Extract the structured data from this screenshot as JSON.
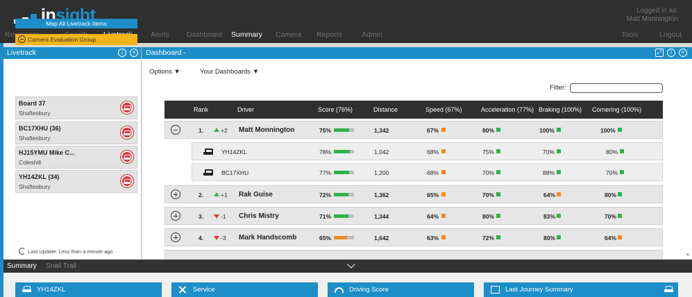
{
  "app": {
    "logo_text_white": "in",
    "logo_text_blue": "sight",
    "user_line1": "Logged in as:",
    "user_line2": "Matt Monnington"
  },
  "nav": {
    "items": [
      "Resources",
      "Search",
      "Livetrack",
      "Alerts",
      "Dashboard",
      "Summary",
      "Camera",
      "Reports",
      "Admin"
    ],
    "right_items": [
      "Tools",
      "Logout"
    ],
    "active": [
      "Livetrack",
      "Summary"
    ]
  },
  "livetrack": {
    "title": "Livetrack",
    "map_all_button": "Map All Livetrack Items",
    "group_label": "Camera Evaluation Group",
    "vehicles": [
      {
        "name": "Board 37",
        "location": "Shaftesbury"
      },
      {
        "name": "BC17XHU (36)",
        "location": "Shaftesbury"
      },
      {
        "name": "HJ15YMU Mike C...",
        "location": "Coleshill"
      },
      {
        "name": "YH14ZKL (34)",
        "location": "Shaftesbury"
      }
    ],
    "last_update": "Last Update: Less than a minute ago"
  },
  "dashboard": {
    "title": "Dashboard -",
    "options_label": "Options",
    "your_dashboards_label": "Your Dashboards",
    "filter_label": "Filter:",
    "filter_value": "",
    "columns": [
      "Rank",
      "Driver",
      "Score (76%)",
      "Distance",
      "Speed (67%)",
      "Acceleration (77%)",
      "Braking (100%)",
      "Cornering (100%)"
    ],
    "colors": {
      "good": "#2db34a",
      "warn": "#f08a24",
      "down": "#e0363e",
      "up": "#2db34a"
    },
    "rows": [
      {
        "rank": "1.",
        "change": "+2",
        "dir": "up",
        "driver": "Matt Monnington",
        "score": "75%",
        "score_frac": 0.75,
        "score_color": "good",
        "distance": "1,342",
        "speed": "67%",
        "speed_color": "warn",
        "accel": "80%",
        "accel_color": "good",
        "braking": "100%",
        "braking_color": "good",
        "cornering": "100%",
        "cornering_color": "good",
        "expanded": true,
        "vehicles": [
          {
            "reg": "YH14ZKL",
            "score": "78%",
            "score_frac": 0.78,
            "distance": "1,042",
            "speed": "68%",
            "accel": "75%",
            "braking": "70%",
            "cornering": "80%"
          },
          {
            "reg": "BC17XHU",
            "score": "77%",
            "score_frac": 0.77,
            "distance": "1,200",
            "speed": "68%",
            "accel": "70%",
            "braking": "88%",
            "cornering": "70%"
          }
        ]
      },
      {
        "rank": "2.",
        "change": "+1",
        "dir": "up",
        "driver": "Rak Guise",
        "score": "72%",
        "score_frac": 0.72,
        "score_color": "good",
        "distance": "1,362",
        "speed": "65%",
        "speed_color": "warn",
        "accel": "70%",
        "accel_color": "good",
        "braking": "64%",
        "braking_color": "warn",
        "cornering": "80%",
        "cornering_color": "good",
        "expanded": false
      },
      {
        "rank": "3.",
        "change": "-1",
        "dir": "down",
        "driver": "Chris Mistry",
        "score": "71%",
        "score_frac": 0.71,
        "score_color": "good",
        "distance": "1,344",
        "speed": "64%",
        "speed_color": "warn",
        "accel": "80%",
        "accel_color": "good",
        "braking": "83%",
        "braking_color": "good",
        "cornering": "70%",
        "cornering_color": "good",
        "expanded": false
      },
      {
        "rank": "4.",
        "change": "-3",
        "dir": "down",
        "driver": "Mark Handscomb",
        "score": "65%",
        "score_frac": 0.65,
        "score_color": "warn",
        "distance": "1,642",
        "speed": "63%",
        "speed_color": "warn",
        "accel": "72%",
        "accel_color": "good",
        "braking": "80%",
        "braking_color": "good",
        "cornering": "64%",
        "cornering_color": "warn",
        "expanded": false
      }
    ]
  },
  "bottom": {
    "tabs_header": [
      "Summary",
      "Snail Trail"
    ],
    "panels": [
      {
        "label": "YH14ZKL",
        "icon": "car-icon"
      },
      {
        "label": "Service",
        "icon": "tools-icon"
      },
      {
        "label": "Driving Score",
        "icon": "gauge-icon"
      },
      {
        "label": "Last Journey Summary",
        "icon": "map-icon"
      }
    ]
  }
}
